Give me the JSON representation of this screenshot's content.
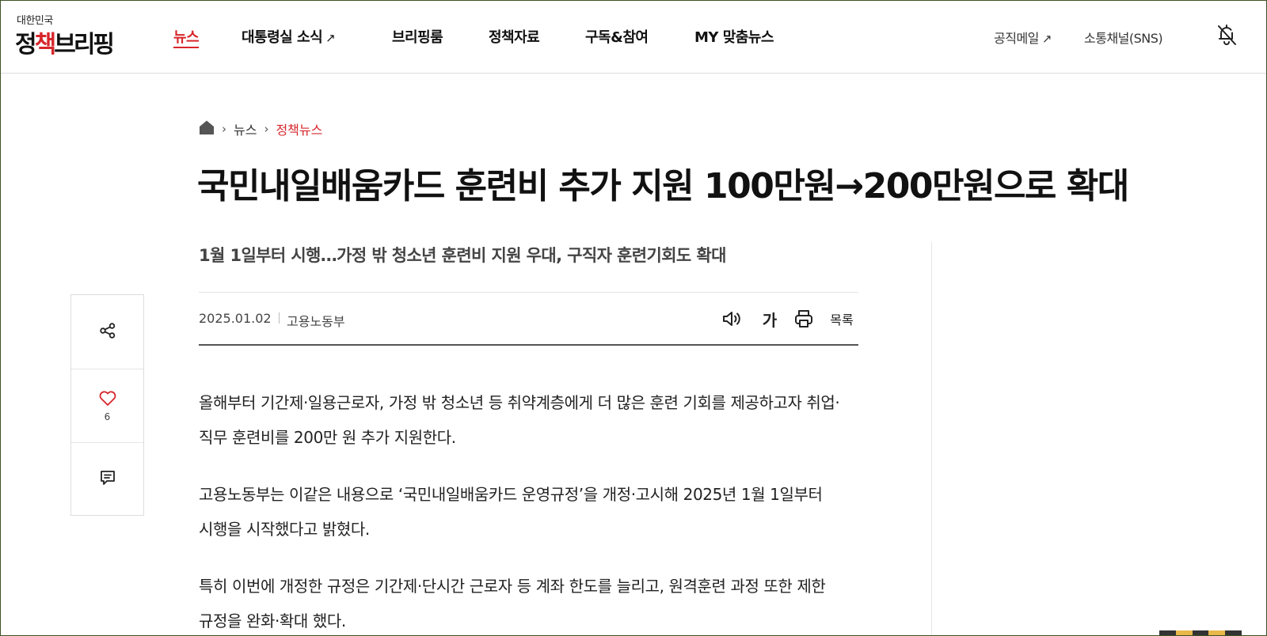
{
  "header": {
    "logo_small": "대한민국",
    "logo_big_1": "정",
    "logo_big_2": "책",
    "logo_big_3": "브리핑",
    "nav": [
      "뉴스",
      "대통령실 소식",
      "브리핑룸",
      "정책자료",
      "구독&참여",
      "MY 맞춤뉴스"
    ],
    "nav_external_arrow": "↗",
    "util_mail": "공직메일",
    "util_mail_arrow": "↗",
    "util_sns": "소통채널(SNS)",
    "bell_icon": "bell-off-icon"
  },
  "breadcrumb": {
    "home_icon": "home-icon",
    "sep": "›",
    "level1": "뉴스",
    "level2": "정책뉴스"
  },
  "article": {
    "title": "국민내일배움카드 훈련비 추가 지원 100만원→200만원으로 확대",
    "subtitle": "1월 1일부터 시행…가정 밖 청소년 훈련비 지원 우대, 구직자 훈련기회도 확대",
    "date": "2025.01.02",
    "dept": "고용노동부",
    "tools": {
      "speaker_icon": "speaker-icon",
      "font_size": "가",
      "print_icon": "print-icon",
      "list": "목록"
    },
    "paragraphs": [
      "올해부터 기간제·일용근로자, 가정 밖 청소년 등 취약계층에게 더 많은 훈련 기회를 제공하고자 취업·직무 훈련비를 200만 원 추가 지원한다.",
      "고용노동부는 이같은 내용으로 ‘국민내일배움카드 운영규정’을 개정·고시해 2025년 1월 1일부터 시행을 시작했다고 밝혔다.",
      "특히 이번에 개정한 규정은 기간제·단시간 근로자 등 계좌 한도를 늘리고, 원격훈련 과정 또한 제한 규정을 완화·확대 했다."
    ]
  },
  "side": {
    "share_icon": "share-icon",
    "like_icon": "heart-icon",
    "like_count": "6",
    "comment_icon": "comment-icon"
  },
  "colors": {
    "accent": "#d7262b",
    "text": "#111111",
    "border": "#dddddd"
  }
}
